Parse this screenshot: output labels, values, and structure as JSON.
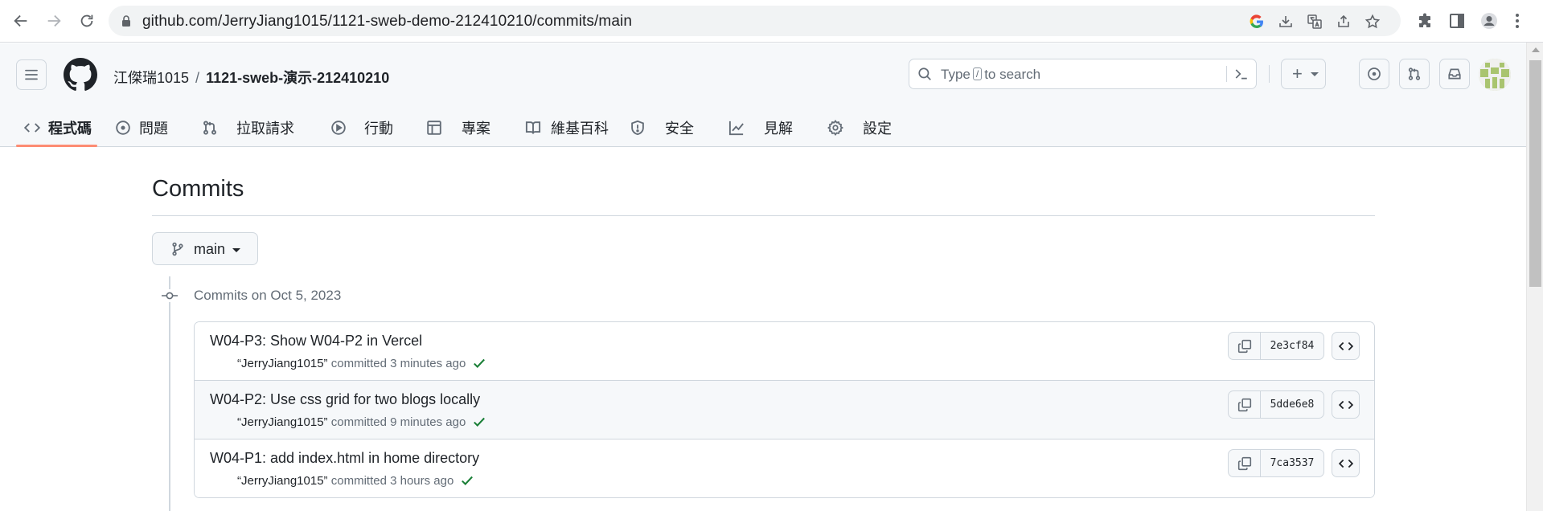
{
  "browser": {
    "url": "github.com/JerryJiang1015/1121-sweb-demo-212410210/commits/main",
    "icons": [
      "back-icon",
      "forward-icon",
      "reload-icon",
      "lock-icon",
      "google-icon",
      "install-icon",
      "translate-icon",
      "share-icon",
      "bookmark-star-icon",
      "extensions-icon",
      "side-panel-icon",
      "profile-icon",
      "more-icon"
    ]
  },
  "header": {
    "owner": "江傑瑞1015",
    "separator": "/",
    "repo": "1121-sweb-演示-212410210",
    "search": {
      "prefix": "Type",
      "key": "/",
      "suffix": "to search"
    },
    "create_label": "+"
  },
  "tabs": [
    {
      "label": "程式碼",
      "icon": "code-icon",
      "active": true
    },
    {
      "label": "問題",
      "icon": "issue-icon",
      "active": false
    },
    {
      "label": "拉取請求",
      "icon": "pull-request-icon",
      "active": false
    },
    {
      "label": "行動",
      "icon": "play-icon",
      "active": false
    },
    {
      "label": "專案",
      "icon": "table-icon",
      "active": false
    },
    {
      "label": "維基百科",
      "icon": "book-icon",
      "active": false
    },
    {
      "label": "安全",
      "icon": "shield-icon",
      "active": false
    },
    {
      "label": "見解",
      "icon": "graph-icon",
      "active": false
    },
    {
      "label": "設定",
      "icon": "gear-icon",
      "active": false
    }
  ],
  "page": {
    "title": "Commits",
    "branch": "main",
    "group_heading": "Commits on Oct 5, 2023"
  },
  "commits": [
    {
      "message": "W04-P3: Show W04-P2 in Vercel",
      "author": "“JerryJiang1015”",
      "action": "committed",
      "time": "3 minutes ago",
      "sha": "2e3cf84",
      "status": "success"
    },
    {
      "message": "W04-P2: Use css grid for two blogs locally",
      "author": "“JerryJiang1015”",
      "action": "committed",
      "time": "9 minutes ago",
      "sha": "5dde6e8",
      "status": "success"
    },
    {
      "message": "W04-P1: add index.html in home directory",
      "author": "“JerryJiang1015”",
      "action": "committed",
      "time": "3 hours ago",
      "sha": "7ca3537",
      "status": "success"
    }
  ],
  "colors": {
    "accent_underline": "#fd8c73",
    "success_check": "#1a7f37",
    "border": "#d0d7de",
    "muted_text": "#636c76"
  }
}
